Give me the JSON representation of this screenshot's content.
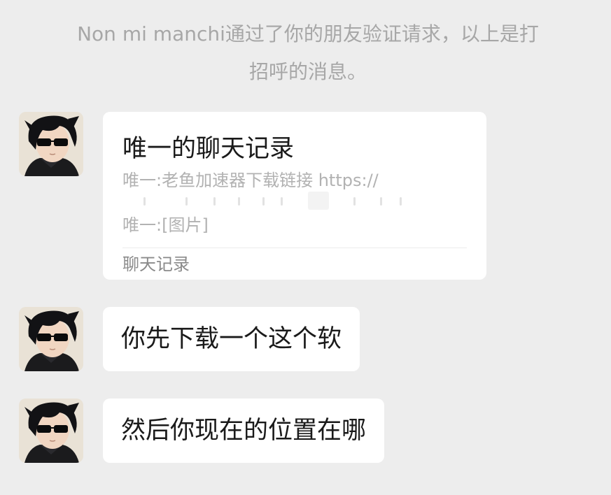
{
  "system_message": {
    "line1": "Non mi manchi通过了你的朋友验证请求，以上是打",
    "line2": "招呼的消息。"
  },
  "messages": [
    {
      "type": "chat-record-card",
      "title": "唯一的聊天记录",
      "lines": [
        "唯一:老鱼加速器下载链接 https://",
        "唯一:[图片]"
      ],
      "footer": "聊天记录"
    },
    {
      "type": "text",
      "text": "你先下载一个这个软"
    },
    {
      "type": "text",
      "text": "然后你现在的位置在哪"
    }
  ],
  "avatar": {
    "icon": "anime-character-sunglasses-avatar"
  },
  "colors": {
    "background": "#ededed",
    "bubble": "#ffffff",
    "system_text": "#a7a7a7",
    "secondary_text": "#b2b2b2"
  }
}
